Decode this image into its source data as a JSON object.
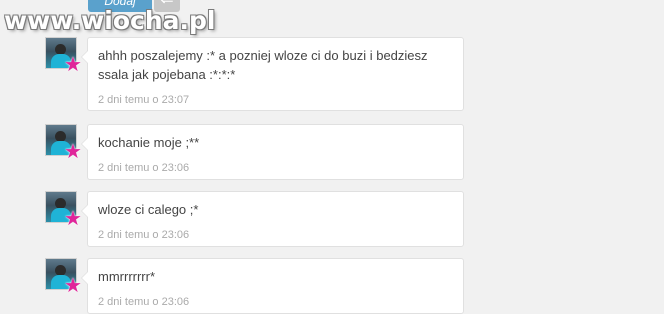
{
  "watermark": {
    "text": "www.wiocha.pl"
  },
  "toolbar": {
    "add_label": "Dodaj",
    "back_glyph": "⇐"
  },
  "colors": {
    "accent": "#5aa1cc",
    "star": "#e0259a",
    "timestamp": "#aaaaaa"
  },
  "icons": {
    "avatar": "user-avatar-icon",
    "badge": "star-badge-icon"
  },
  "messages": [
    {
      "text": "ahhh poszalejemy :* a pozniej wloze ci do buzi i bedziesz ssala jak pojebana :*:*:*",
      "time": "2 dni temu o 23:07"
    },
    {
      "text": "kochanie moje ;**",
      "time": "2 dni temu o 23:06"
    },
    {
      "text": "wloze ci calego ;*",
      "time": "2 dni temu o 23:06"
    },
    {
      "text": "mmrrrrrrr*",
      "time": "2 dni temu o 23:06"
    }
  ]
}
